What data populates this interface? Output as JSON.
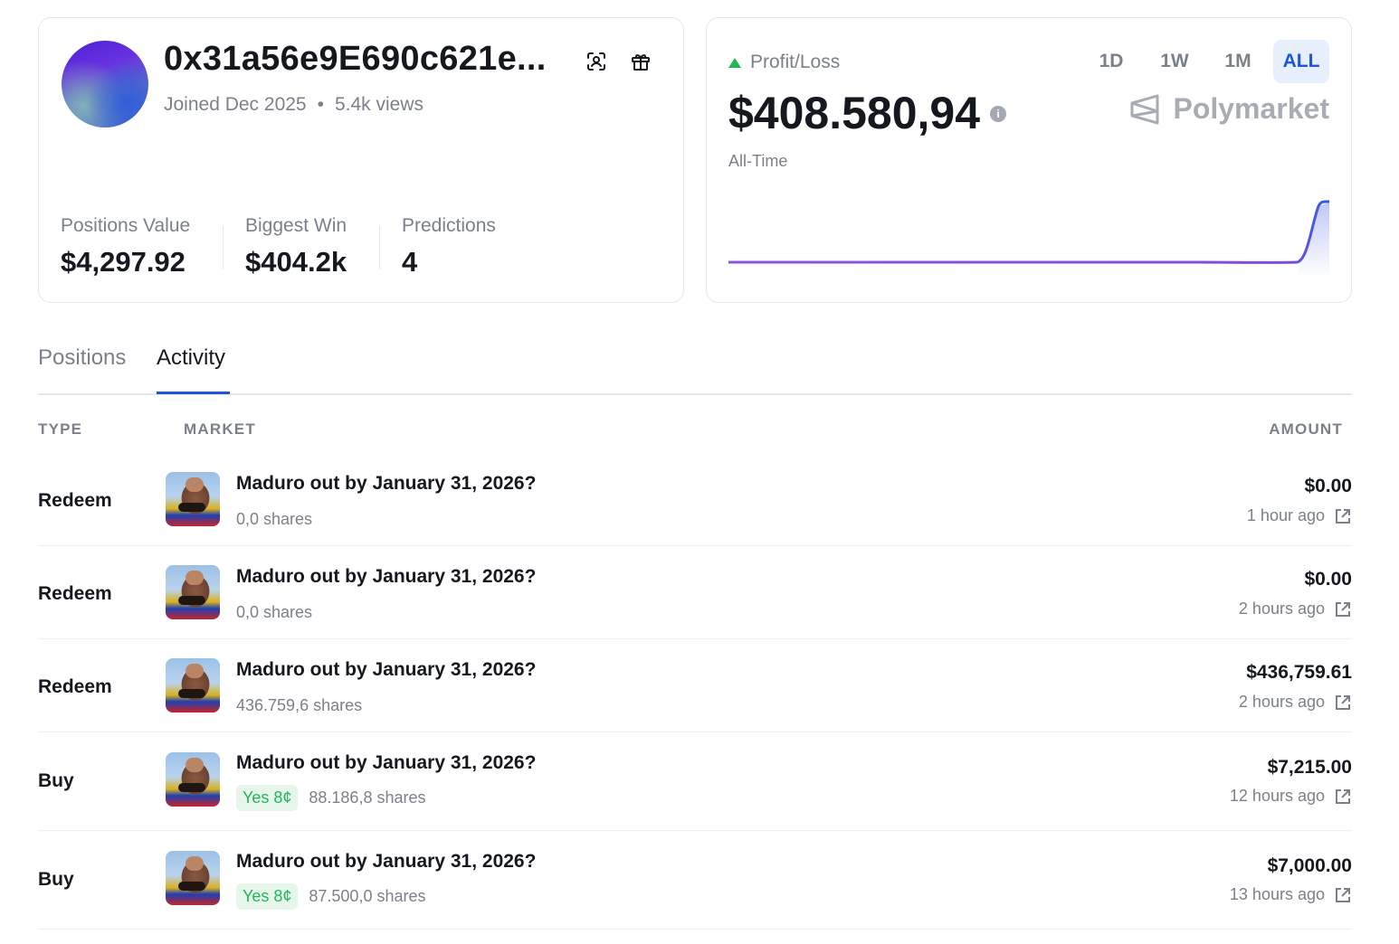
{
  "profile": {
    "address": "0x31a56e9E690c621e...",
    "joined": "Joined Dec 2025",
    "views": "5.4k views",
    "stats": [
      {
        "label": "Positions Value",
        "value": "$4,297.92"
      },
      {
        "label": "Biggest Win",
        "value": "$404.2k"
      },
      {
        "label": "Predictions",
        "value": "4"
      }
    ],
    "icons": [
      "scan-icon",
      "gift-icon"
    ]
  },
  "pnl": {
    "label": "Profit/Loss",
    "value": "$408.580,94",
    "period_label": "All-Time",
    "ranges": [
      "1D",
      "1W",
      "1M",
      "ALL"
    ],
    "active_range": "ALL",
    "brand": "Polymarket",
    "trend_color": "#1fb954",
    "line_color_start": "#7c4ddb",
    "line_color_end": "#2c5ee8"
  },
  "tabs": [
    "Positions",
    "Activity"
  ],
  "active_tab": "Activity",
  "columns": {
    "type": "TYPE",
    "market": "MARKET",
    "amount": "AMOUNT"
  },
  "activity": [
    {
      "type": "Redeem",
      "market": "Maduro out by January 31, 2026?",
      "badge": "",
      "shares": "0,0 shares",
      "amount": "$0.00",
      "time": "1 hour ago"
    },
    {
      "type": "Redeem",
      "market": "Maduro out by January 31, 2026?",
      "badge": "",
      "shares": "0,0 shares",
      "amount": "$0.00",
      "time": "2 hours ago"
    },
    {
      "type": "Redeem",
      "market": "Maduro out by January 31, 2026?",
      "badge": "",
      "shares": "436.759,6 shares",
      "amount": "$436,759.61",
      "time": "2 hours ago"
    },
    {
      "type": "Buy",
      "market": "Maduro out by January 31, 2026?",
      "badge": "Yes 8¢",
      "shares": "88.186,8 shares",
      "amount": "$7,215.00",
      "time": "12 hours ago"
    },
    {
      "type": "Buy",
      "market": "Maduro out by January 31, 2026?",
      "badge": "Yes 8¢",
      "shares": "87.500,0 shares",
      "amount": "$7,000.00",
      "time": "13 hours ago"
    }
  ]
}
